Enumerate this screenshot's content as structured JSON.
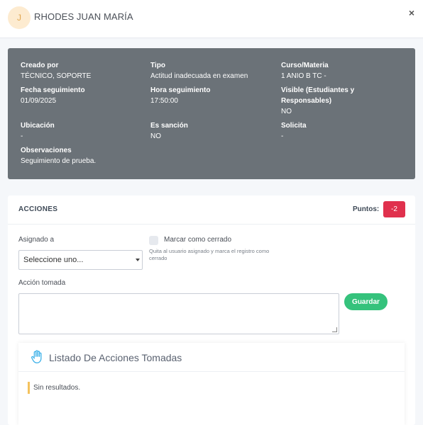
{
  "header": {
    "avatar_initial": "J",
    "student_name": "RHODES JUAN MARÍA",
    "close_label": "×"
  },
  "info": {
    "created_by": {
      "label": "Creado por",
      "value": "TÉCNICO, SOPORTE"
    },
    "type": {
      "label": "Tipo",
      "value": "Actitud inadecuada en examen"
    },
    "course": {
      "label": "Curso/Materia",
      "value": "1 ANIO B TC -"
    },
    "follow_date": {
      "label": "Fecha seguimiento",
      "value": "01/09/2025"
    },
    "follow_time": {
      "label": "Hora seguimiento",
      "value": "17:50:00"
    },
    "visible": {
      "label_line1": "Visible (Estudiantes y",
      "label_line2": "Responsables)",
      "value": "NO"
    },
    "location": {
      "label": "Ubicación",
      "value": "-"
    },
    "sanction": {
      "label": "Es sanción",
      "value": "NO"
    },
    "requests": {
      "label": "Solicita",
      "value": "-"
    },
    "observations": {
      "label": "Observaciones",
      "value": "Seguimiento de prueba."
    }
  },
  "actions": {
    "title": "ACCIONES",
    "points_label": "Puntos:",
    "points_value": "-2",
    "assign_label": "Asignado a",
    "assign_selected": "Seleccione uno...",
    "close_checkbox_label": "Marcar como cerrado",
    "close_checkbox_help": "Quita al usuario asignado y marca el registro como cerrado",
    "close_checkbox_checked": false,
    "action_label": "Acción tomada",
    "action_value": "",
    "save_label": "Guardar"
  },
  "list": {
    "title": "Listado De Acciones Tomadas",
    "empty_text": "Sin resultados."
  },
  "colors": {
    "info_panel_bg": "#6b7278",
    "points_badge": "#e0314d",
    "save_button": "#35c27c",
    "empty_marker": "#f4c25d",
    "hand_icon": "#3ab0e8"
  }
}
